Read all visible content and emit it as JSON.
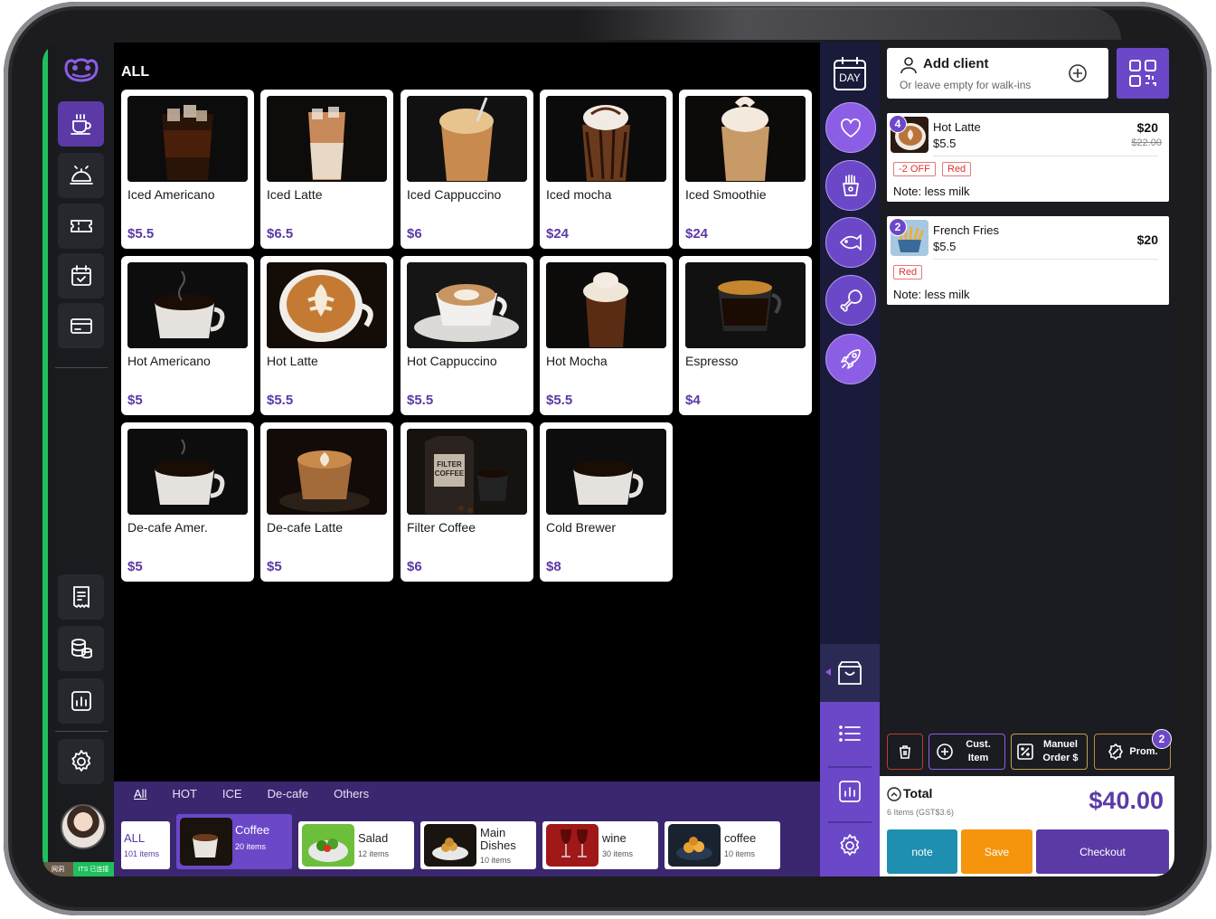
{
  "sidebar": {
    "status_left": "网洞",
    "status_right": "ITS 已连接"
  },
  "header": {
    "title": "ALL"
  },
  "products": [
    {
      "name": "Iced Americano",
      "price": "$5.5"
    },
    {
      "name": "Iced Latte",
      "price": "$6.5"
    },
    {
      "name": "Iced Cappuccino",
      "price": "$6"
    },
    {
      "name": "Iced mocha",
      "price": "$24"
    },
    {
      "name": "Iced Smoothie",
      "price": "$24"
    },
    {
      "name": "Hot Americano",
      "price": "$5"
    },
    {
      "name": "Hot Latte",
      "price": "$5.5"
    },
    {
      "name": "Hot Cappuccino",
      "price": "$5.5"
    },
    {
      "name": "Hot Mocha",
      "price": "$5.5"
    },
    {
      "name": "Espresso",
      "price": "$4"
    },
    {
      "name": "De-cafe Amer.",
      "price": "$5"
    },
    {
      "name": "De-cafe Latte",
      "price": "$5"
    },
    {
      "name": "Filter Coffee",
      "price": "$6"
    },
    {
      "name": "Cold Brewer",
      "price": "$8"
    }
  ],
  "filter_tabs": [
    "All",
    "HOT",
    "ICE",
    "De-cafe",
    "Others"
  ],
  "categories": [
    {
      "name": "ALL",
      "count": "101 items"
    },
    {
      "name": "Coffee",
      "count": "20 items"
    },
    {
      "name": "Salad",
      "count": "12 items"
    },
    {
      "name": "Main Dishes",
      "count": "10 items"
    },
    {
      "name": "wine",
      "count": "30 items"
    },
    {
      "name": "coffee",
      "count": "10 items"
    }
  ],
  "rail": {
    "day_label": "DAY"
  },
  "client": {
    "title": "Add client",
    "subtitle": "Or leave empty for walk-ins"
  },
  "orders": [
    {
      "qty": "4",
      "name": "Hot Latte",
      "unit_price": "$5.5",
      "total": "$20",
      "original": "$22.00",
      "tags": [
        "-2 OFF",
        "Red"
      ],
      "note": "Note: less milk"
    },
    {
      "qty": "2",
      "name": "French Fries",
      "unit_price": "$5.5",
      "total": "$20",
      "tags": [
        "Red"
      ],
      "note": "Note: less milk"
    }
  ],
  "actions": {
    "custom_item": "Cust. Item",
    "manual_order": "Manuel Order $",
    "promo": "Prom.",
    "promo_badge": "2"
  },
  "totals": {
    "label": "Total",
    "sub": "6 Items (GST$3.6)",
    "amount": "$40.00"
  },
  "buttons": {
    "note": "note",
    "save": "Save",
    "checkout": "Checkout"
  },
  "colors": {
    "accent": "#6b48c8",
    "price": "#5b3aa6",
    "note_btn": "#1e8fb0",
    "save_btn": "#f5950e",
    "checkout_btn": "#5b3aa6",
    "status_green": "#1fbf5d"
  }
}
